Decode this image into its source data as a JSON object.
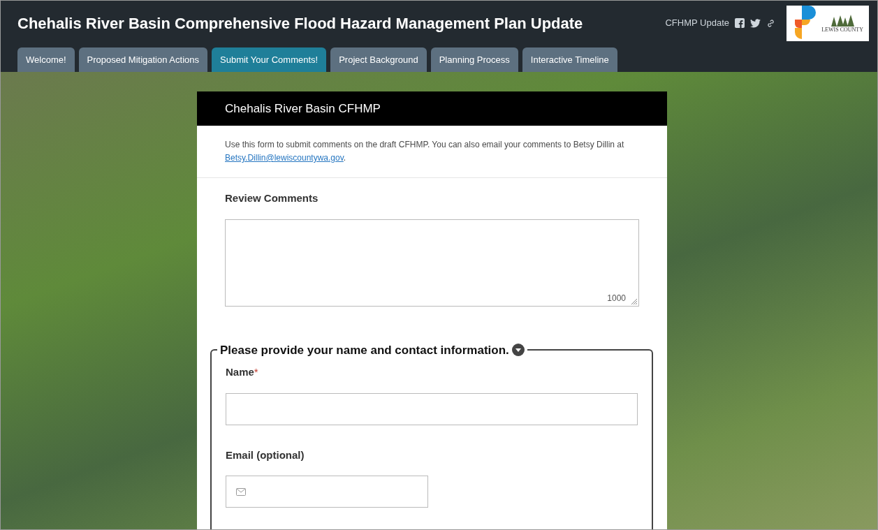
{
  "header": {
    "title": "Chehalis River Basin Comprehensive Flood Hazard Management Plan Update",
    "short_title": "CFHMP Update",
    "logo_text": "LEWIS COUNTY"
  },
  "tabs": [
    {
      "label": "Welcome!",
      "selected": false
    },
    {
      "label": "Proposed Mitigation Actions",
      "selected": false
    },
    {
      "label": "Submit Your Comments!",
      "selected": true
    },
    {
      "label": "Project Background",
      "selected": false
    },
    {
      "label": "Planning Process",
      "selected": false
    },
    {
      "label": "Interactive Timeline",
      "selected": false
    }
  ],
  "form": {
    "title": "Chehalis River Basin CFHMP",
    "intro": "Use this form to submit comments on the draft CFHMP. You can also email your comments to Betsy Dillin at ",
    "intro_link": "Betsy.Dillin@lewiscountywa.gov",
    "intro_end": ".",
    "comments": {
      "label": "Review Comments",
      "counter": "1000"
    },
    "contact": {
      "legend": "Please provide your name and contact information.",
      "expanded": true,
      "fields": [
        {
          "label": "Name",
          "required": true,
          "required_mark": "*",
          "kind": "text"
        },
        {
          "label": "Email (optional)",
          "required": false,
          "kind": "email"
        }
      ]
    }
  }
}
